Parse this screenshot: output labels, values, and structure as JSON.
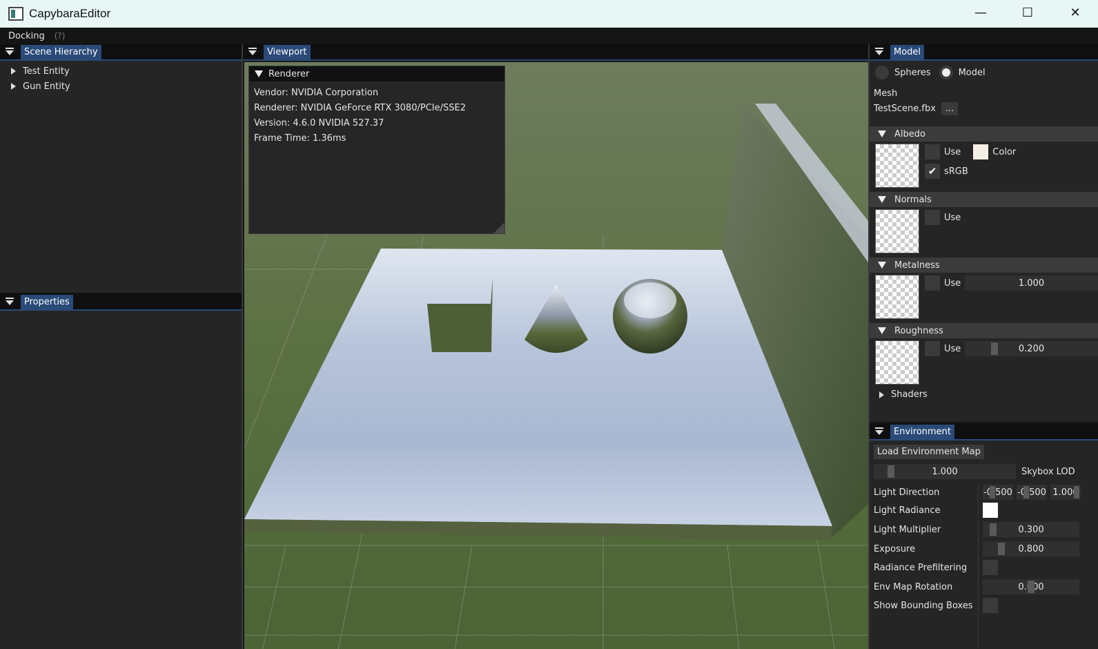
{
  "window": {
    "title": "CapybaraEditor",
    "minimize": "—",
    "maximize": "☐",
    "close": "✕"
  },
  "menu": {
    "docking": "Docking",
    "help": "(?)"
  },
  "scene_hierarchy": {
    "tab": "Scene Hierarchy",
    "items": [
      {
        "label": "Test Entity"
      },
      {
        "label": "Gun Entity"
      }
    ]
  },
  "properties": {
    "tab": "Properties"
  },
  "viewport": {
    "tab": "Viewport",
    "renderer": {
      "title": "Renderer",
      "vendor": "Vendor: NVIDIA Corporation",
      "renderer": "Renderer: NVIDIA GeForce RTX 3080/PCIe/SSE2",
      "version": "Version: 4.6.0 NVIDIA 527.37",
      "frame_time": "Frame Time: 1.36ms"
    }
  },
  "model": {
    "tab": "Model",
    "radio_spheres": "Spheres",
    "radio_model": "Model",
    "selected": "Model",
    "mesh_label": "Mesh",
    "mesh_file": "TestScene.fbx",
    "browse": "...",
    "albedo": {
      "title": "Albedo",
      "use": "Use",
      "use_checked": false,
      "color_label": "Color",
      "color": "#f5f0e6",
      "srgb": "sRGB",
      "srgb_checked": true
    },
    "normals": {
      "title": "Normals",
      "use": "Use",
      "use_checked": false
    },
    "metalness": {
      "title": "Metalness",
      "use": "Use",
      "use_checked": false,
      "value": "1.000",
      "fraction": 1.0
    },
    "roughness": {
      "title": "Roughness",
      "use": "Use",
      "use_checked": false,
      "value": "0.200",
      "fraction": 0.2
    },
    "shaders": "Shaders"
  },
  "environment": {
    "tab": "Environment",
    "load_button": "Load Environment Map",
    "skybox_lod": {
      "value": "1.000",
      "label": "Skybox LOD"
    },
    "light_direction": {
      "label": "Light Direction",
      "x": "-0.500",
      "y": "-0.500",
      "z": "1.000"
    },
    "light_radiance": {
      "label": "Light Radiance",
      "color": "#ffffff"
    },
    "light_multiplier": {
      "label": "Light Multiplier",
      "value": "0.300"
    },
    "exposure": {
      "label": "Exposure",
      "value": "0.800"
    },
    "radiance_prefiltering": {
      "label": "Radiance Prefiltering",
      "checked": false
    },
    "env_map_rotation": {
      "label": "Env Map Rotation",
      "value": "0.000"
    },
    "show_bounding_boxes": {
      "label": "Show Bounding Boxes",
      "checked": false
    }
  },
  "colors": {
    "accent": "#2a4a78",
    "panel": "#252525",
    "titlebar": "#e8f6f6",
    "sky_top": "#8aa0c0",
    "grass": "#4e6a38"
  }
}
